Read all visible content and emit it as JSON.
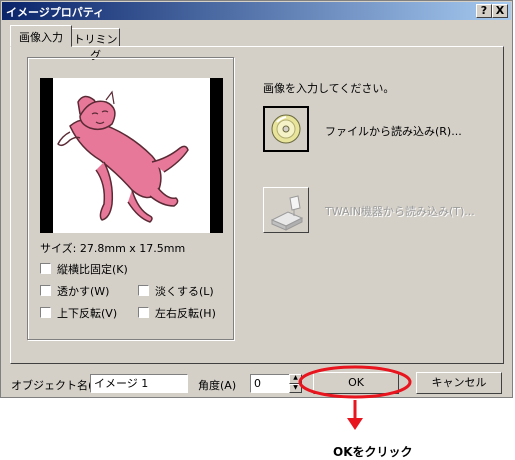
{
  "window": {
    "title": "イメージプロパティ",
    "help_label": "?",
    "close_label": "X"
  },
  "tabs": [
    {
      "label": "画像入力"
    },
    {
      "label": "トリミング"
    }
  ],
  "preview": {
    "size_text": "サイズ: 27.8mm x 17.5mm"
  },
  "options": {
    "keep_ratio": "縦横比固定(K)",
    "transparent": "透かす(W)",
    "lighten": "淡くする(L)",
    "flip_vertical": "上下反転(V)",
    "flip_horizontal": "左右反転(H)"
  },
  "prompt": "画像を入力してください。",
  "load_file": "ファイルから読み込み(R)...",
  "load_twain": "TWAIN機器から読み込み(T)...",
  "object_name": {
    "label": "オブジェクト名(O)",
    "value": "イメージ 1"
  },
  "angle": {
    "label": "角度(A)",
    "value": "0"
  },
  "ok_label": "OK",
  "cancel_label": "キャンセル",
  "annotation": {
    "text": "OKをクリック",
    "color": "#e8141e"
  }
}
